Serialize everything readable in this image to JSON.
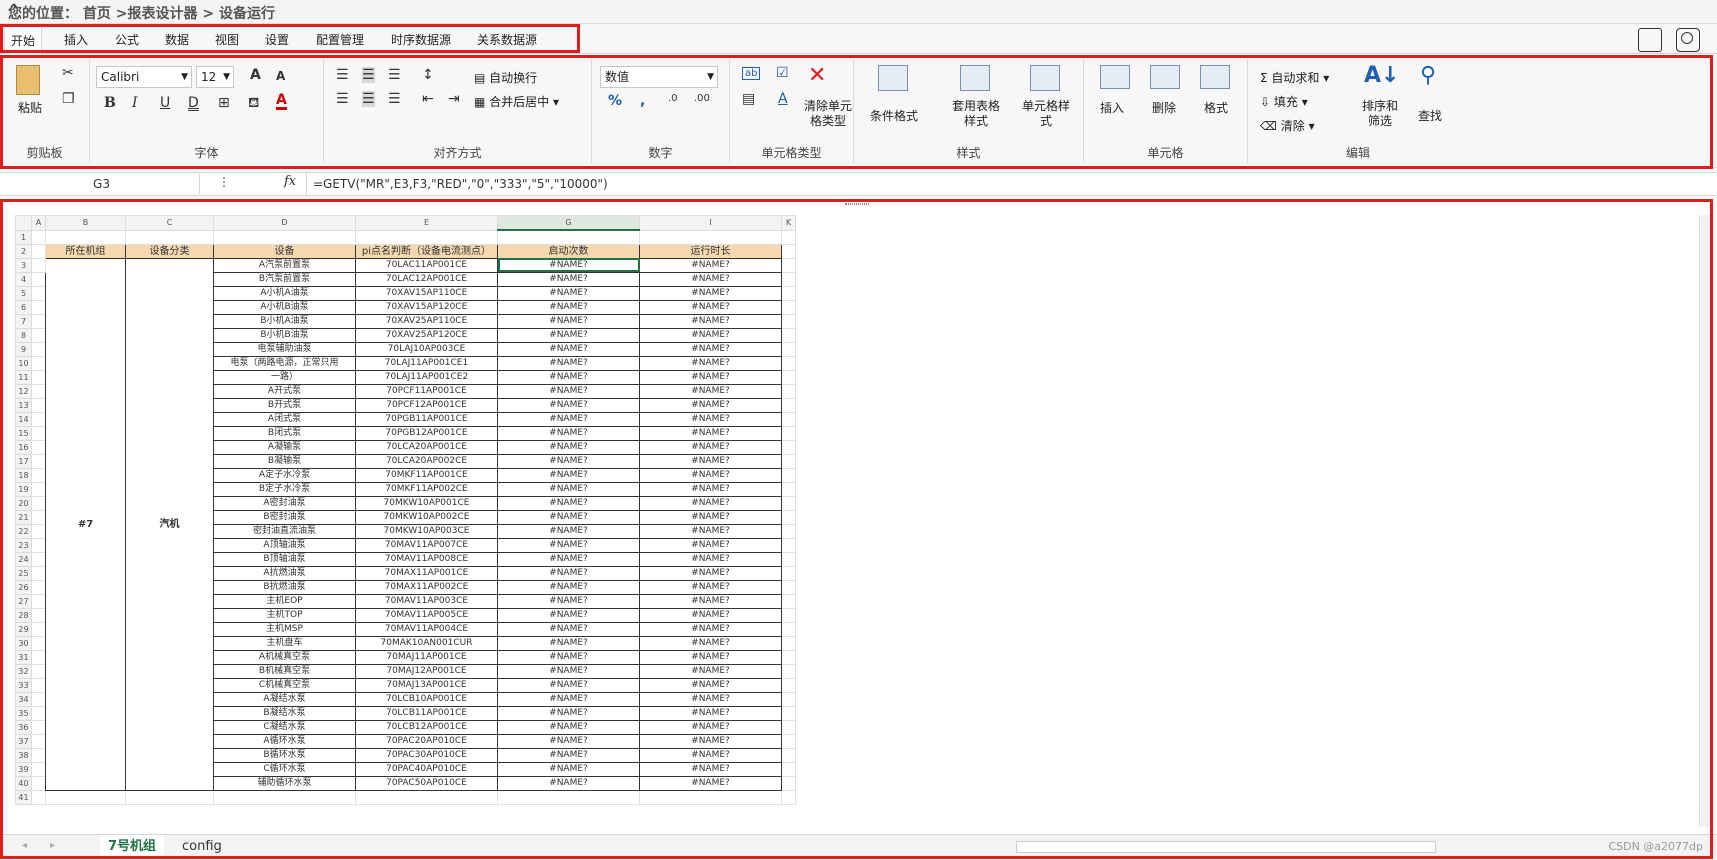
{
  "breadcrumb": {
    "text": "您的位置： 首页 >报表设计器 > 设备运行"
  },
  "tabs": [
    "开始",
    "插入",
    "公式",
    "数据",
    "视图",
    "设置",
    "配置管理",
    "时序数据源",
    "关系数据源"
  ],
  "ribbon": {
    "clipboard": {
      "label": "剪贴板",
      "paste": "粘贴"
    },
    "font": {
      "label": "字体",
      "name": "Calibri",
      "size": "12"
    },
    "align": {
      "label": "对齐方式",
      "wrap": "自动换行",
      "merge": "合并后居中"
    },
    "number": {
      "label": "数字",
      "format": "数值"
    },
    "celltype": {
      "label": "单元格类型",
      "clear": "清除单元格类型"
    },
    "style": {
      "label": "样式",
      "cond": "条件格式",
      "table": "套用表格样式",
      "cellstyle": "单元格样式"
    },
    "cells": {
      "label": "单元格",
      "insert": "插入",
      "delete": "删除",
      "format": "格式"
    },
    "edit": {
      "label": "编辑",
      "autosum": "自动求和",
      "fill": "填充",
      "clear": "清除",
      "sort": "排序和筛选",
      "find": "查找"
    }
  },
  "formula": {
    "namebox": "G3",
    "text": "=GETV(\"MR\",E3,F3,\"RED\",\"0\",\"333\",\"5\",\"10000\")"
  },
  "sheet": {
    "cols": [
      "A",
      "B",
      "C",
      "D",
      "E",
      "G",
      "I",
      "K"
    ],
    "headers": [
      "所在机组",
      "设备分类",
      "设备",
      "pi点名判断（设备电流测点）",
      "启动次数",
      "运行时长"
    ],
    "unit": "#7",
    "category": "汽机",
    "err1": "#NAME?",
    "err2": "#NAME?",
    "rows": [
      [
        "A汽泵前置泵",
        "70LAC11AP001CE"
      ],
      [
        "B汽泵前置泵",
        "70LAC12AP001CE"
      ],
      [
        "A小机A油泵",
        "70XAV15AP110CE"
      ],
      [
        "A小机B油泵",
        "70XAV15AP120CE"
      ],
      [
        "B小机A油泵",
        "70XAV25AP110CE"
      ],
      [
        "B小机B油泵",
        "70XAV25AP120CE"
      ],
      [
        "电泵辅助油泵",
        "70LAJ10AP003CE"
      ],
      [
        "电泵（两路电源，正常只用",
        "70LAJ11AP001CE1"
      ],
      [
        "一路）",
        "70LAJ11AP001CE2"
      ],
      [
        "A开式泵",
        "70PCF11AP001CE"
      ],
      [
        "B开式泵",
        "70PCF12AP001CE"
      ],
      [
        "A闭式泵",
        "70PGB11AP001CE"
      ],
      [
        "B闭式泵",
        "70PGB12AP001CE"
      ],
      [
        "A凝输泵",
        "70LCA20AP001CE"
      ],
      [
        "B凝输泵",
        "70LCA20AP002CE"
      ],
      [
        "A定子水冷泵",
        "70MKF11AP001CE"
      ],
      [
        "B定子水冷泵",
        "70MKF11AP002CE"
      ],
      [
        "A密封油泵",
        "70MKW10AP001CE"
      ],
      [
        "B密封油泵",
        "70MKW10AP002CE"
      ],
      [
        "密封油直流油泵",
        "70MKW10AP003CE"
      ],
      [
        "A顶轴油泵",
        "70MAV11AP007CE"
      ],
      [
        "B顶轴油泵",
        "70MAV11AP008CE"
      ],
      [
        "A抗燃油泵",
        "70MAX11AP001CE"
      ],
      [
        "B抗燃油泵",
        "70MAX11AP002CE"
      ],
      [
        "主机EOP",
        "70MAV11AP003CE"
      ],
      [
        "主机TOP",
        "70MAV11AP005CE"
      ],
      [
        "主机MSP",
        "70MAV11AP004CE"
      ],
      [
        "主机盘车",
        "70MAK10AN001CUR"
      ],
      [
        "A机械真空泵",
        "70MAJ11AP001CE"
      ],
      [
        "B机械真空泵",
        "70MAJ12AP001CE"
      ],
      [
        "C机械真空泵",
        "70MAJ13AP001CE"
      ],
      [
        "A凝结水泵",
        "70LCB10AP001CE"
      ],
      [
        "B凝结水泵",
        "70LCB11AP001CE"
      ],
      [
        "C凝结水泵",
        "70LCB12AP001CE"
      ],
      [
        "A循环水泵",
        "70PAC20AP010CE"
      ],
      [
        "B循环水泵",
        "70PAC30AP010CE"
      ],
      [
        "C循环水泵",
        "70PAC40AP010CE"
      ],
      [
        "辅助循环水泵",
        "70PAC50AP010CE"
      ]
    ]
  },
  "sheettabs": [
    "7号机组",
    "config"
  ],
  "watermark": "CSDN @a2077dp"
}
